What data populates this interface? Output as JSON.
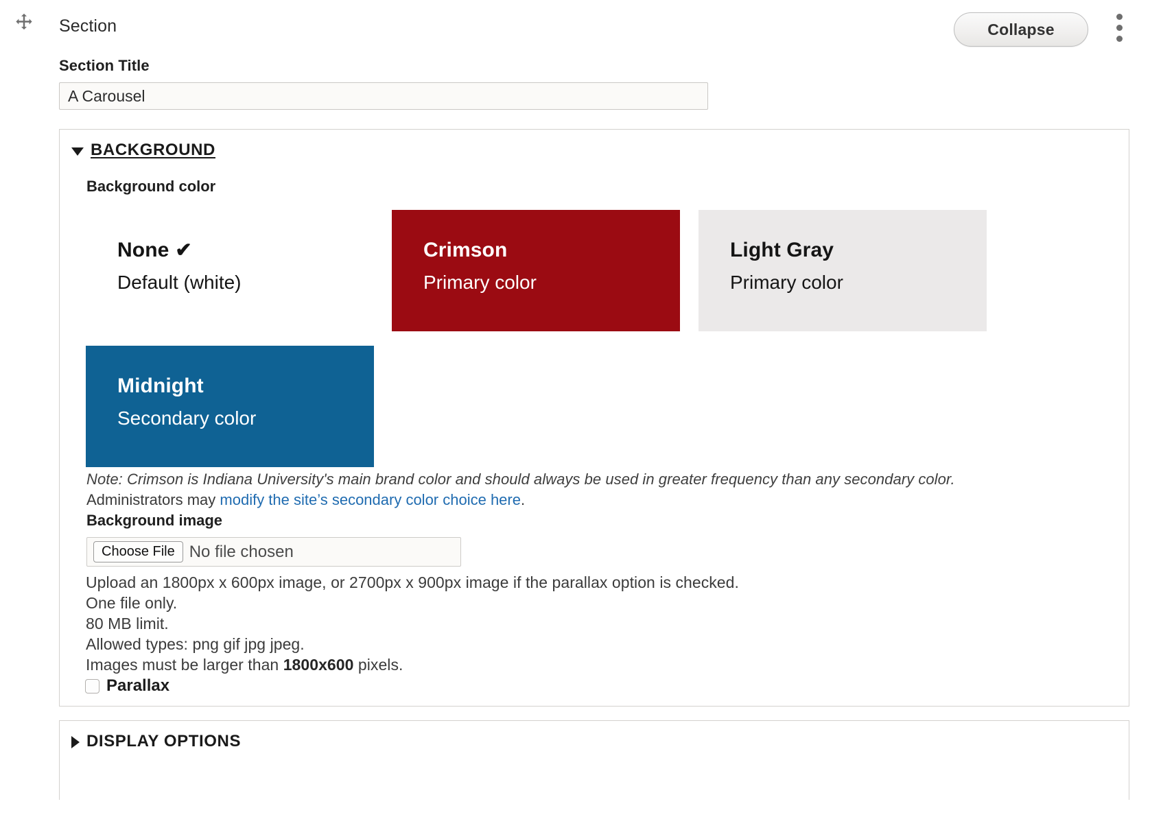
{
  "header": {
    "drag_icon": "move-handle-icon",
    "section_kind": "Section",
    "collapse_label": "Collapse",
    "kebab_icon": "vertical-ellipsis-icon"
  },
  "section_title": {
    "label": "Section Title",
    "value": "A Carousel",
    "placeholder": ""
  },
  "background_panel": {
    "toggle_label": "BACKGROUND",
    "expanded": true,
    "triangle_icon": "triangle-down-icon",
    "color_label": "Background color",
    "swatches": [
      {
        "name": "None",
        "sub": "Default (white)",
        "selected": true,
        "check_glyph": "✔",
        "bg": "#ffffff",
        "fg": "#141414"
      },
      {
        "name": "Crimson",
        "sub": "Primary color",
        "selected": false,
        "check_glyph": "",
        "bg": "#9b0b12",
        "fg": "#ffffff"
      },
      {
        "name": "Light Gray",
        "sub": "Primary color",
        "selected": false,
        "check_glyph": "",
        "bg": "#ebe9e9",
        "fg": "#151515"
      },
      {
        "name": "Midnight",
        "sub": "Secondary color",
        "selected": false,
        "check_glyph": "",
        "bg": "#0f6294",
        "fg": "#ffffff"
      }
    ],
    "note": "Note: Crimson is Indiana University's main brand color and should always be used in greater frequency than any secondary color.",
    "admin_prefix": "Administrators may ",
    "admin_link": "modify the site’s secondary color choice here",
    "admin_suffix": ".",
    "admin_link_color": "#1f6bb0",
    "background_image": {
      "label": "Background image",
      "choose_file_label": "Choose File",
      "file_status": "No file chosen",
      "help_lines": [
        "Upload an 1800px x 600px image, or 2700px x 900px image if the parallax option is checked.",
        "One file only.",
        "80 MB limit.",
        "Allowed types: png gif jpg jpeg."
      ],
      "min_size_prefix": "Images must be larger than ",
      "min_size_value": "1800x600",
      "min_size_suffix": " pixels."
    },
    "parallax": {
      "label": "Parallax",
      "checked": false
    }
  },
  "display_panel": {
    "toggle_label": "DISPLAY OPTIONS",
    "expanded": false,
    "triangle_icon": "triangle-right-icon"
  }
}
